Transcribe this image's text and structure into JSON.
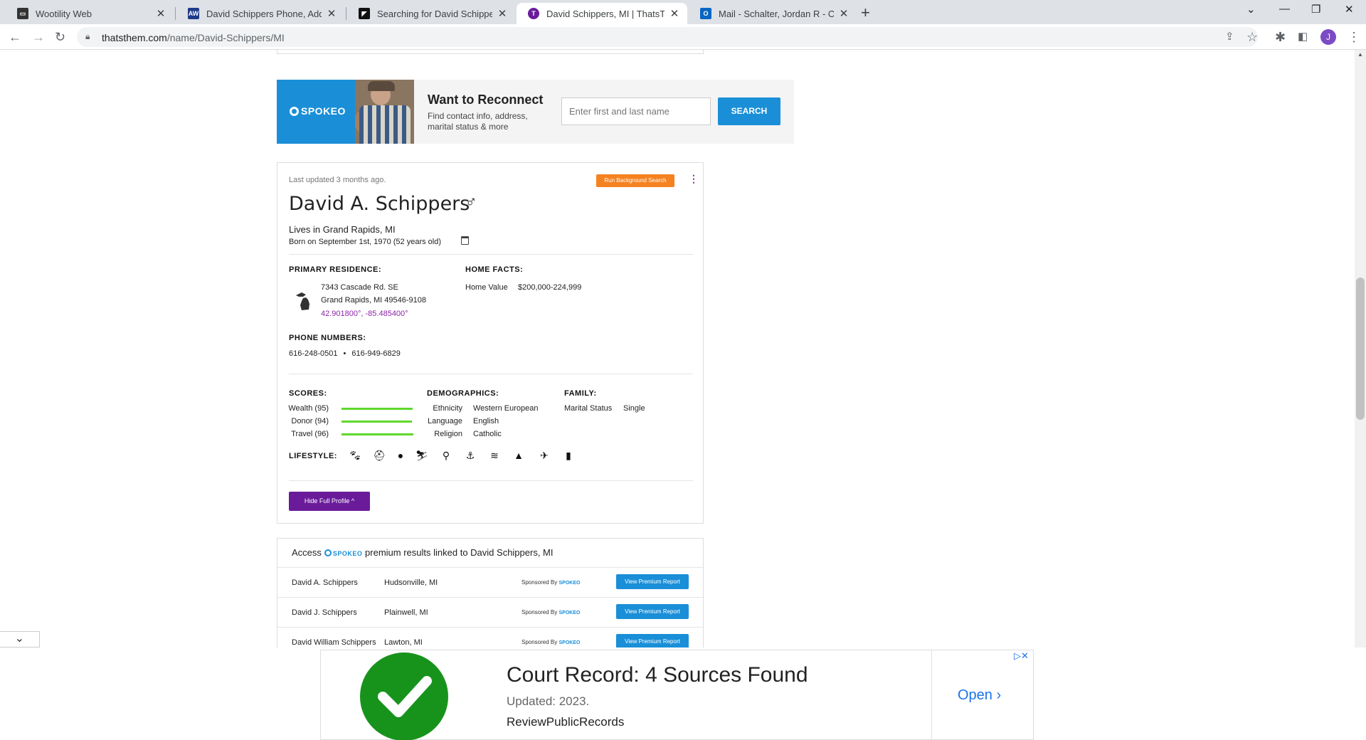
{
  "tabs": [
    {
      "title": "Wootility Web",
      "favicon_color": "#333333",
      "active": false
    },
    {
      "title": "David Schippers Phone, Address",
      "favicon_color": "#1e3a8a",
      "active": false
    },
    {
      "title": "Searching for David Schippers in",
      "favicon_color": "#111111",
      "active": false
    },
    {
      "title": "David Schippers, MI | ThatsThem",
      "favicon_color": "#6a1b9a",
      "active": true
    },
    {
      "title": "Mail - Schalter, Jordan R - Outloo",
      "favicon_color": "#0a66c2",
      "active": false
    }
  ],
  "toolbar": {
    "url_domain": "thatsthem.com",
    "url_path": "/name/David-Schippers/MI",
    "profile_initial": "J"
  },
  "banner": {
    "logo": "SPOKEO",
    "heading": "Want to Reconnect",
    "text": "Find contact info, address, marital status & more",
    "input_placeholder": "Enter first and last name",
    "button": "SEARCH"
  },
  "profile": {
    "updated": "Last updated 3 months ago.",
    "run_button": "Run Background Search",
    "name": "David A. Schippers",
    "gender_symbol": "♂",
    "lives": "Lives in Grand Rapids, MI",
    "born": "Born on September 1st, 1970 (52 years old)",
    "residence_heading": "PRIMARY RESIDENCE:",
    "address_line1": "7343 Cascade Rd. SE",
    "address_line2": "Grand Rapids, MI 49546-9108",
    "coordinates": "42.901800°, -85.485400°",
    "home_heading": "HOME FACTS:",
    "home_value_label": "Home Value",
    "home_value": "$200,000-224,999",
    "phones_heading": "PHONE NUMBERS:",
    "phones": [
      "616-248-0501",
      "616-949-6829"
    ],
    "scores_heading": "SCORES:",
    "scores": [
      {
        "label": "Wealth (95)",
        "value": 95
      },
      {
        "label": "Donor (94)",
        "value": 94
      },
      {
        "label": "Travel (96)",
        "value": 96
      }
    ],
    "demo_heading": "DEMOGRAPHICS:",
    "demographics": [
      {
        "label": "Ethnicity",
        "value": "Western European"
      },
      {
        "label": "Language",
        "value": "English"
      },
      {
        "label": "Religion",
        "value": "Catholic"
      }
    ],
    "family_heading": "FAMILY:",
    "family_label": "Marital Status",
    "family_value": "Single",
    "lifestyle_heading": "LIFESTYLE:",
    "lifestyle_icons": [
      "paw-icon",
      "helmet-icon",
      "balloon-icon",
      "skier-icon",
      "motorcycle-icon",
      "anchor-icon",
      "waves-icon",
      "mountain-icon",
      "airplane-icon",
      "book-icon"
    ],
    "hide_button": "Hide Full Profile ^"
  },
  "premium": {
    "prefix": "Access",
    "brand": "SPOKEO",
    "middle": "premium results linked to",
    "subject": "David Schippers, MI",
    "sponsored_label": "Sponsored By",
    "sponsor_brand": "SPOKEO",
    "view_button": "View Premium Report",
    "rows": [
      {
        "name": "David A. Schippers",
        "location": "Hudsonville, MI"
      },
      {
        "name": "David J. Schippers",
        "location": "Plainwell, MI"
      },
      {
        "name": "David William Schippers",
        "location": "Lawton, MI"
      }
    ]
  },
  "ad": {
    "title": "Court Record: 4 Sources Found",
    "updated": "Updated: 2023.",
    "source": "ReviewPublicRecords",
    "open": "Open ›"
  },
  "colors": {
    "spokeo_blue": "#1a8fd8",
    "thatsthem_purple": "#6a1b9a",
    "run_orange": "#f58220",
    "score_green": "#5fd82b",
    "ad_check_green": "#17931c"
  }
}
